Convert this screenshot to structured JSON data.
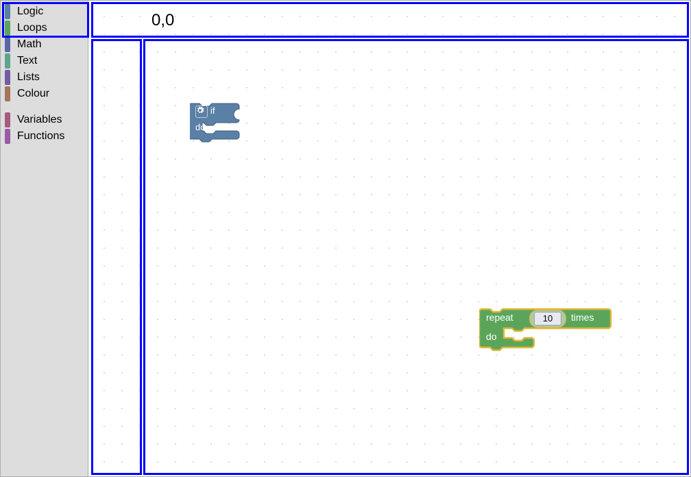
{
  "debug_label": "0,0",
  "toolbox": {
    "categories": [
      {
        "name": "Logic",
        "color": "#5b80a5"
      },
      {
        "name": "Loops",
        "color": "#5ba55b"
      },
      {
        "name": "Math",
        "color": "#5b67a5"
      },
      {
        "name": "Text",
        "color": "#5ba58c"
      },
      {
        "name": "Lists",
        "color": "#745ba5"
      },
      {
        "name": "Colour",
        "color": "#a5745b"
      },
      {
        "name": "Variables",
        "color": "#a55b80"
      },
      {
        "name": "Functions",
        "color": "#995ba5"
      }
    ],
    "gap_after_index": 5
  },
  "blocks": {
    "if_block": {
      "if_label": "if",
      "do_label": "do",
      "gear_icon": "gear-icon",
      "fill": "#5b80a5",
      "stroke": "#3d5b7a"
    },
    "repeat_block": {
      "repeat_label": "repeat",
      "times_label": "times",
      "do_label": "do",
      "count_value": "10",
      "fill": "#5ba55b",
      "selection_stroke": "#e0b73a",
      "selected": true
    }
  }
}
